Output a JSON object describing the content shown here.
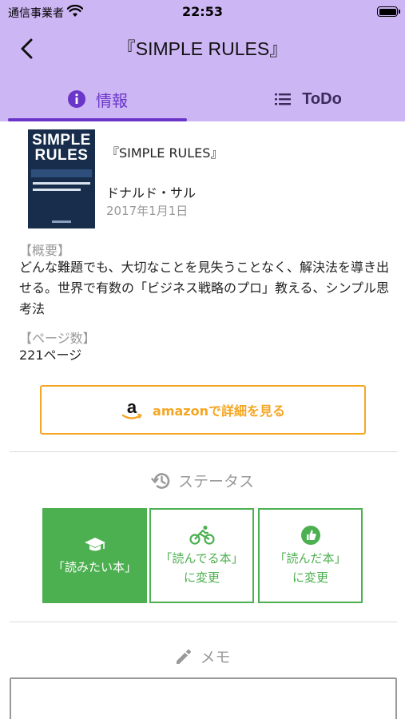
{
  "status_bar": {
    "carrier": "通信事業者",
    "time": "22:53"
  },
  "nav": {
    "title": "『SIMPLE RULES』"
  },
  "tabs": [
    {
      "label": "情報",
      "icon": "info-icon",
      "selected": true
    },
    {
      "label": "ToDo",
      "icon": "list-icon",
      "selected": false
    }
  ],
  "book": {
    "cover_text_line1": "SIMPLE",
    "cover_text_line2": "RULES",
    "title": "『SIMPLE RULES』",
    "author": "ドナルド・サル",
    "date": "2017年1月1日"
  },
  "summary": {
    "label": "【概要】",
    "text": "どんな難題でも、大切なことを見失うことなく、解決法を導き出せる。世界で有数の「ビジネス戦略のプロ」教える、シンプル思考法"
  },
  "pages": {
    "label": "【ページ数】",
    "value": "221ページ"
  },
  "amazon_button": {
    "label": "amazonで詳細を見る",
    "icon": "amazon-logo-icon"
  },
  "status_section": {
    "label": "ステータス",
    "icon": "history-icon",
    "buttons": [
      {
        "line1": "「読みたい本」",
        "line2": "",
        "icon": "graduation-cap-icon",
        "active": true
      },
      {
        "line1": "「読んでる本」",
        "line2": "に変更",
        "icon": "bicycle-icon",
        "active": false
      },
      {
        "line1": "「読んだ本」",
        "line2": "に変更",
        "icon": "thumbs-up-icon",
        "active": false
      }
    ]
  },
  "memo_section": {
    "label": "メモ",
    "icon": "pencil-icon",
    "value": ""
  },
  "colors": {
    "header_bg": "#cdb6f4",
    "accent_purple": "#6a35c9",
    "amazon_orange": "#f5a623",
    "status_green": "#4caf50"
  }
}
